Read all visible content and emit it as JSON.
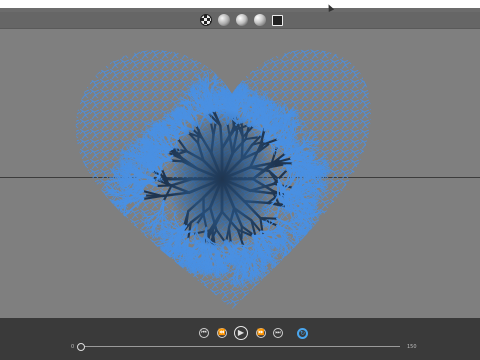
{
  "toolbar": {
    "icons": [
      "checker-icon",
      "grey-sphere-icon",
      "mesh-sphere-icon",
      "shiny-sphere-icon",
      "fit-frame-icon"
    ]
  },
  "viewport": {
    "background": "#7f7f7f",
    "branch_color": "#4a90e2",
    "core_color": "#1f3550"
  },
  "playback": {
    "accent": "#4aa6ee",
    "start_label": "0",
    "end_label": "150",
    "buttons": {
      "first": "⏮",
      "prev": "⏪",
      "play": "▶",
      "next": "⏩",
      "last": "⏭",
      "loop": "↻"
    }
  }
}
